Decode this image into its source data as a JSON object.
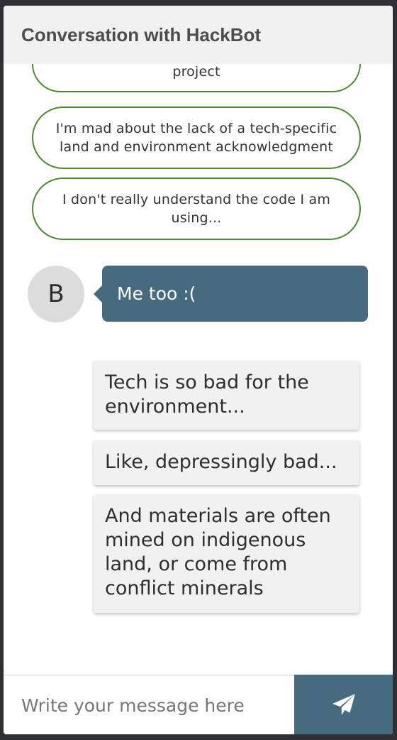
{
  "header": {
    "title": "Conversation with HackBot"
  },
  "options": [
    {
      "label": "project"
    },
    {
      "label": "I'm mad about the lack of a tech-specific land and environment acknowledgment"
    },
    {
      "label": "I don't really understand the code I am using..."
    }
  ],
  "user_message": {
    "avatar_initial": "B",
    "text": "Me too :("
  },
  "bot_messages": [
    {
      "text": "Tech is so bad for the environment..."
    },
    {
      "text": "Like, depressingly bad..."
    },
    {
      "text": "And materials are often mined on indigenous land, or come from conflict minerals"
    }
  ],
  "composer": {
    "placeholder": "Write your message here",
    "value": "",
    "send_icon": "paper-plane-icon"
  },
  "colors": {
    "accent": "#476b7e",
    "option_border": "#4a8a2c",
    "header_bg": "#f1f1f1",
    "bot_bubble_bg": "#f1f1f1"
  }
}
